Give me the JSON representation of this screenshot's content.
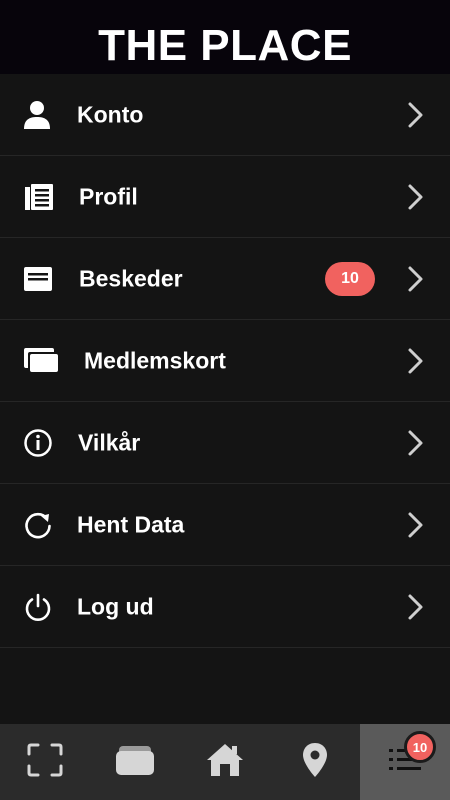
{
  "app": {
    "title": "THE PLACE"
  },
  "menu": {
    "items": [
      {
        "label": "Konto",
        "icon": "user-icon"
      },
      {
        "label": "Profil",
        "icon": "document-icon"
      },
      {
        "label": "Beskeder",
        "icon": "inbox-icon",
        "badge": "10"
      },
      {
        "label": "Medlemskort",
        "icon": "cards-icon"
      },
      {
        "label": "Vilkår",
        "icon": "info-icon"
      },
      {
        "label": "Hent Data",
        "icon": "refresh-icon"
      },
      {
        "label": "Log ud",
        "icon": "power-icon"
      }
    ]
  },
  "tabbar": {
    "tabs": [
      {
        "icon": "scan-icon"
      },
      {
        "icon": "wallet-icon"
      },
      {
        "icon": "home-icon"
      },
      {
        "icon": "location-pin-icon"
      },
      {
        "icon": "menu-list-icon",
        "badge": "10",
        "active": true
      }
    ]
  },
  "colors": {
    "badge": "#f1625f",
    "header_bg": "#07040b",
    "background": "#141414",
    "tabbar_bg": "#2b2b2b",
    "tab_active_bg": "#5a5a5a"
  }
}
